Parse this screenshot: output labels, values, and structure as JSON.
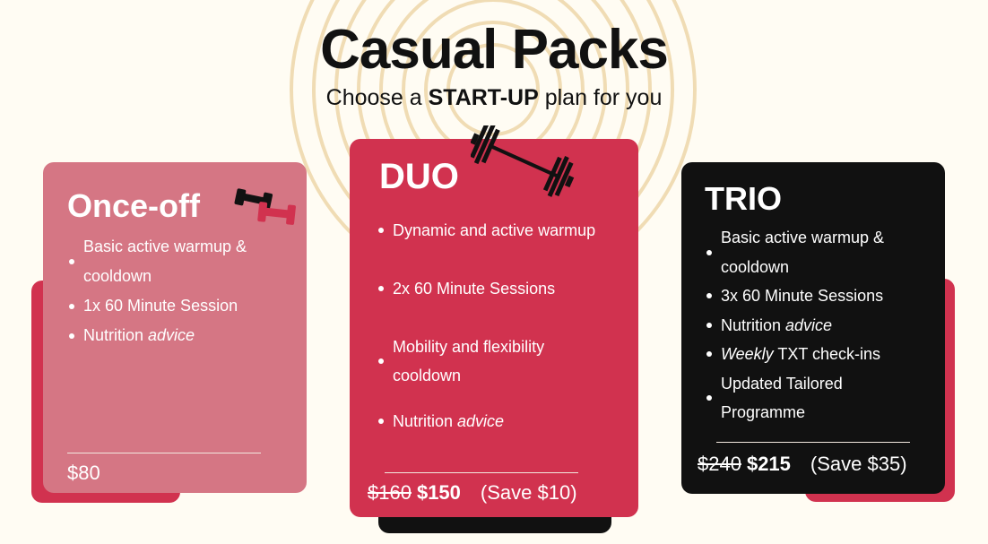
{
  "header": {
    "title": "Casual Packs",
    "subtitle_pre": "Choose a ",
    "subtitle_bold": "START-UP",
    "subtitle_post": " plan for you"
  },
  "colors": {
    "background": "#fffcf3",
    "pink": "#d57684",
    "red": "#d1324f",
    "black": "#111111",
    "rings": "#f0dcb4"
  },
  "plans": [
    {
      "name": "Once-off",
      "icon": "dumbbells-icon",
      "features": [
        {
          "text": "Basic active warmup & cooldown"
        },
        {
          "text": "1x  60 Minute Session"
        },
        {
          "text": "Nutrition ",
          "em": "advice"
        }
      ],
      "price": "$80"
    },
    {
      "name": "DUO",
      "icon": "barbell-icon",
      "features": [
        {
          "text": "Dynamic and active warmup"
        },
        {
          "text": "2x  60 Minute Sessions"
        },
        {
          "text": "Mobility and flexibility cooldown"
        },
        {
          "text": "Nutrition ",
          "em": "advice"
        }
      ],
      "old_price": "$160",
      "price": "$150",
      "save": "(Save $10)"
    },
    {
      "name": "TRIO",
      "features": [
        {
          "text": "Basic active warmup & cooldown"
        },
        {
          "text": "3x  60 Minute Sessions"
        },
        {
          "text": "Nutrition ",
          "em": "advice"
        },
        {
          "em_first": "Weekly",
          "text": " TXT check-ins"
        },
        {
          "text": "Updated Tailored Programme"
        }
      ],
      "old_price": "$240",
      "price": "$215",
      "save": "(Save $35)"
    }
  ]
}
